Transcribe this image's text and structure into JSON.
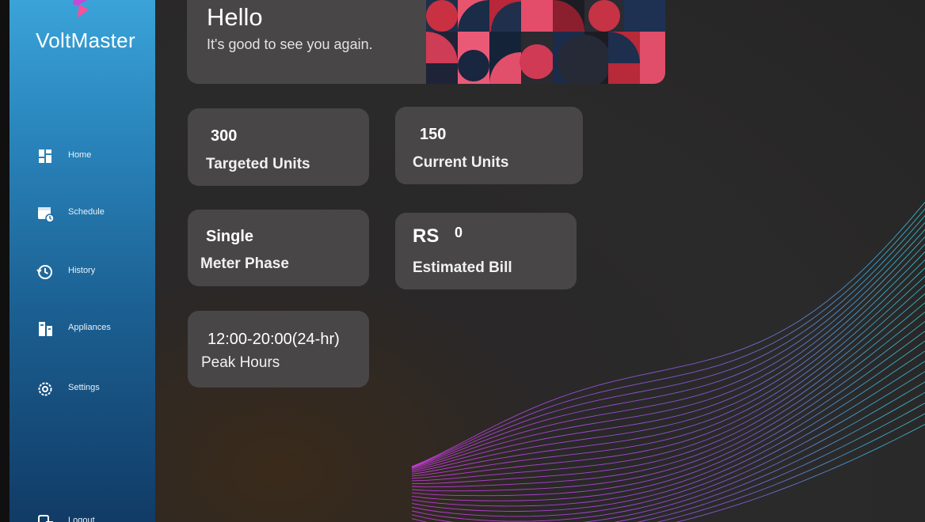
{
  "app": {
    "brand": "VoltMaster"
  },
  "sidebar": {
    "items": [
      {
        "label": "Home",
        "icon": "dashboard-icon"
      },
      {
        "label": "Schedule",
        "icon": "calendar-icon"
      },
      {
        "label": "History",
        "icon": "history-icon"
      },
      {
        "label": "Appliances",
        "icon": "appliances-icon"
      },
      {
        "label": "Settings",
        "icon": "gear-icon"
      },
      {
        "label": "Logout",
        "icon": "logout-icon"
      }
    ]
  },
  "greeting": {
    "title": "Hello",
    "subtitle": "It's good to see you again."
  },
  "stats": {
    "targeted_units": {
      "value": "300",
      "label": "Targeted Units"
    },
    "current_units": {
      "value": "150",
      "label": "Current Units"
    },
    "meter_phase": {
      "value": "Single",
      "label": "Meter Phase"
    },
    "estimated_bill": {
      "currency": "RS",
      "value": "0",
      "label": "Estimated Bill"
    },
    "peak_hours": {
      "value": "12:00-20:00(24-hr)",
      "label": "Peak Hours"
    }
  },
  "colors": {
    "sidebar_top": "#3aa3d8",
    "sidebar_bottom": "#113b66",
    "card": "#484646",
    "background": "#2b2a2a"
  }
}
